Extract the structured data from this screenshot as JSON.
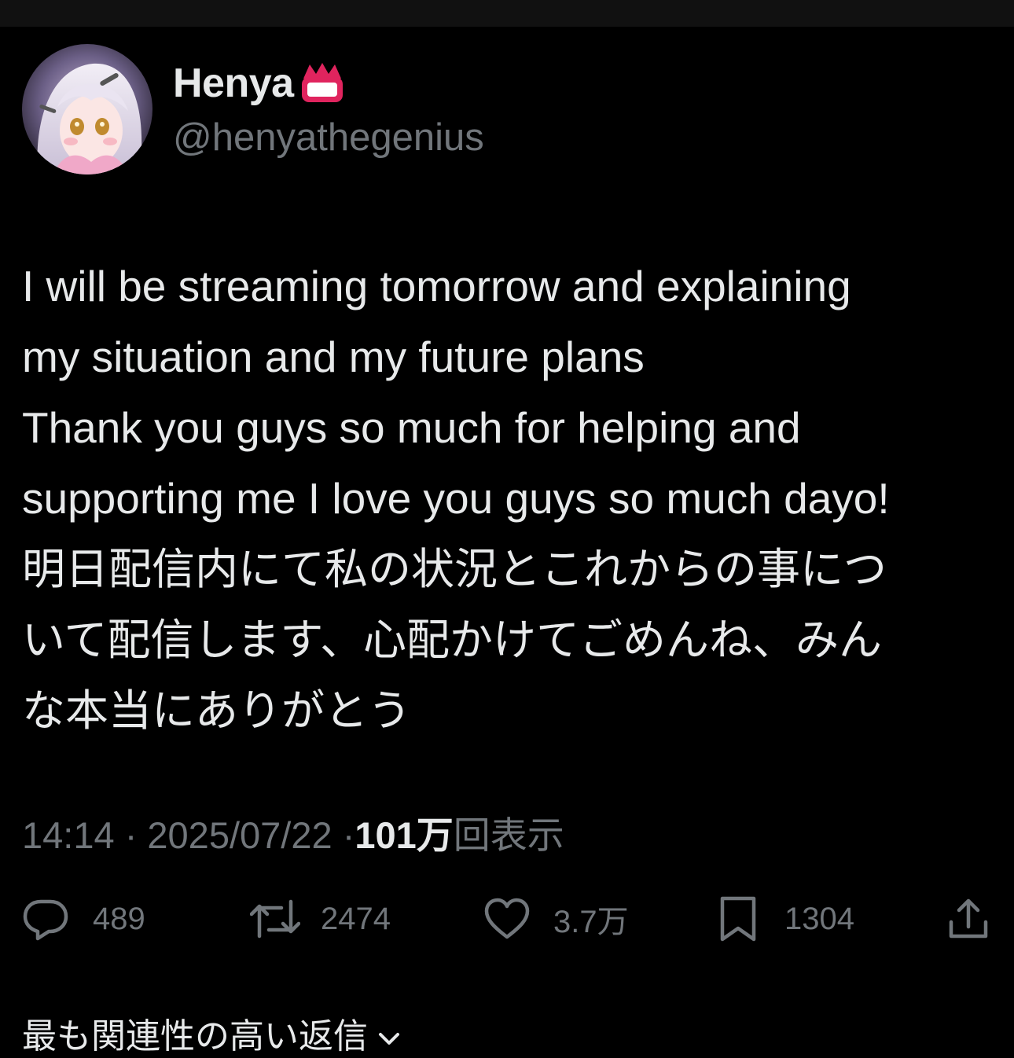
{
  "user": {
    "display_name": "Henya",
    "badge_icon": "crown-badge-icon",
    "handle": "@henyathegenius"
  },
  "tweet": {
    "text": "I will be streaming tomorrow and explaining\nmy situation and my future plans\nThank you guys so much for helping and\nsupporting me I love you guys so much dayo!\n明日配信内にて私の状況とこれからの事につ\nいて配信します、心配かけてごめんね、みん\nな本当にありがとう",
    "time": "14:14",
    "separator": "·",
    "date": "2025/07/22",
    "views_count": "101万",
    "views_label": "回表示"
  },
  "actions": {
    "reply": {
      "icon": "reply-icon",
      "count": "489"
    },
    "repost": {
      "icon": "repost-icon",
      "count": "2474"
    },
    "like": {
      "icon": "heart-icon",
      "count": "3.7万"
    },
    "bookmark": {
      "icon": "bookmark-icon",
      "count": "1304"
    },
    "share": {
      "icon": "share-icon"
    }
  },
  "replies_sort": {
    "label": "最も関連性の高い返信",
    "icon": "chevron-down-icon"
  },
  "colors": {
    "background": "#000000",
    "primary_text": "#e7e9ea",
    "secondary_text": "#71767b",
    "badge_red": "#e0245e"
  }
}
